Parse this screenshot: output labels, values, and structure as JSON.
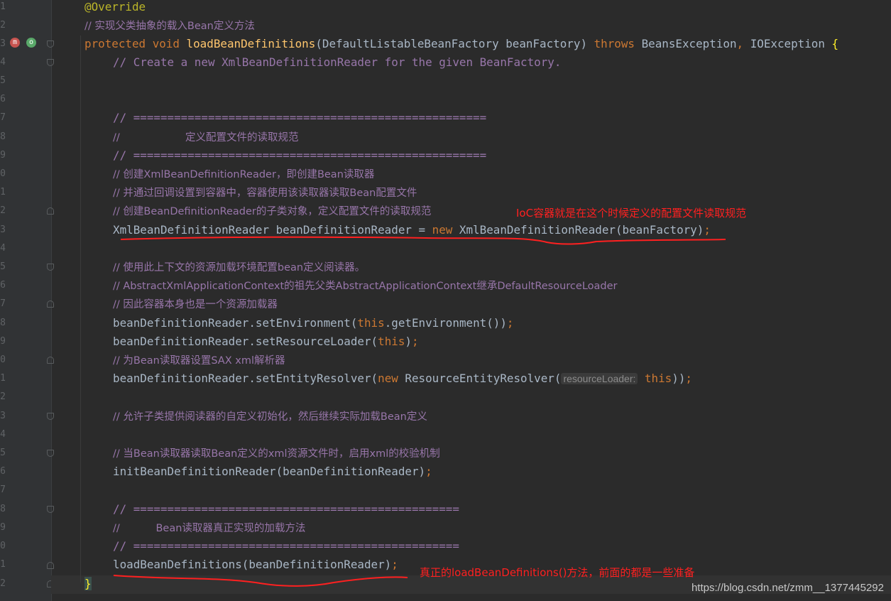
{
  "gutter": {
    "line_numbers": [
      "1",
      "2",
      "3",
      "4",
      "5",
      "6",
      "7",
      "8",
      "9",
      "0",
      "1",
      "2",
      "3",
      "4",
      "5",
      "6",
      "7",
      "8",
      "9",
      "0",
      "1",
      "2",
      "3",
      "4",
      "5",
      "6",
      "7",
      "8",
      "9",
      "0",
      "1",
      "2"
    ],
    "icons": [
      "overrides-method-icon",
      "implemented-method-icon"
    ]
  },
  "code": {
    "l1": "@Override",
    "l2": "// 实现父类抽象的载入Bean定义方法",
    "l3_kw1": "protected",
    "l3_kw2": "void",
    "l3_name": "loadBeanDefinitions",
    "l3_params": "(DefaultListableBeanFactory beanFactory)",
    "l3_throws": "throws",
    "l3_ex": "BeansException",
    "l3_comma": ",",
    "l3_ex2": "IOException",
    "l3_brace": "{",
    "l4": "// Create a new XmlBeanDefinitionReader for the given BeanFactory.",
    "l7": "// ====================================================",
    "l8": "//                    定义配置文件的读取规范",
    "l9": "// ====================================================",
    "l10": "// 创建XmlBeanDefinitionReader，即创建Bean读取器",
    "l11": "// 并通过回调设置到容器中，容器使用该读取器读取Bean配置文件",
    "l12": "// 创建BeanDefinitionReader的子类对象，定义配置文件的读取规范",
    "l13_a": "XmlBeanDefinitionReader beanDefinitionReader = ",
    "l13_new": "new",
    "l13_b": " XmlBeanDefinitionReader(beanFactory)",
    "l13_semi": ";",
    "l15": "// 使用此上下文的资源加载环境配置bean定义阅读器。",
    "l16": "// AbstractXmlApplicationContext的祖先父类AbstractApplicationContext继承DefaultResourceLoader",
    "l17": "// 因此容器本身也是一个资源加载器",
    "l18_a": "beanDefinitionReader.setEnvironment(",
    "l18_this": "this",
    "l18_b": ".getEnvironment())",
    "l18_semi": ";",
    "l19_a": "beanDefinitionReader.setResourceLoader(",
    "l19_this": "this",
    "l19_b": ")",
    "l19_semi": ";",
    "l20": "// 为Bean读取器设置SAX xml解析器",
    "l21_a": "beanDefinitionReader.setEntityResolver(",
    "l21_new": "new",
    "l21_b": " ResourceEntityResolver(",
    "l21_hint": "resourceLoader:",
    "l21_this": "this",
    "l21_c": "))",
    "l21_semi": ";",
    "l23": "// 允许子类提供阅读器的自定义初始化，然后继续实际加载Bean定义",
    "l25": "// 当Bean读取器读取Bean定义的xml资源文件时，启用xml的校验机制",
    "l26_a": "initBeanDefinitionReader(beanDefinitionReader)",
    "l26_semi": ";",
    "l28": "// ================================================",
    "l29": "//           Bean读取器真正实现的加载方法",
    "l30": "// ================================================",
    "l31_a": "loadBeanDefinitions(beanDefinitionReader)",
    "l31_semi": ";",
    "l32": "}"
  },
  "annotations": {
    "note1": "IoC容器就是在这个时候定义的配置文件读取规范",
    "note2": "真正的loadBeanDefinitions()方法，前面的都是一些准备",
    "watermark": "https://blog.csdn.net/zmm__1377445292",
    "color": "#ff2020"
  }
}
